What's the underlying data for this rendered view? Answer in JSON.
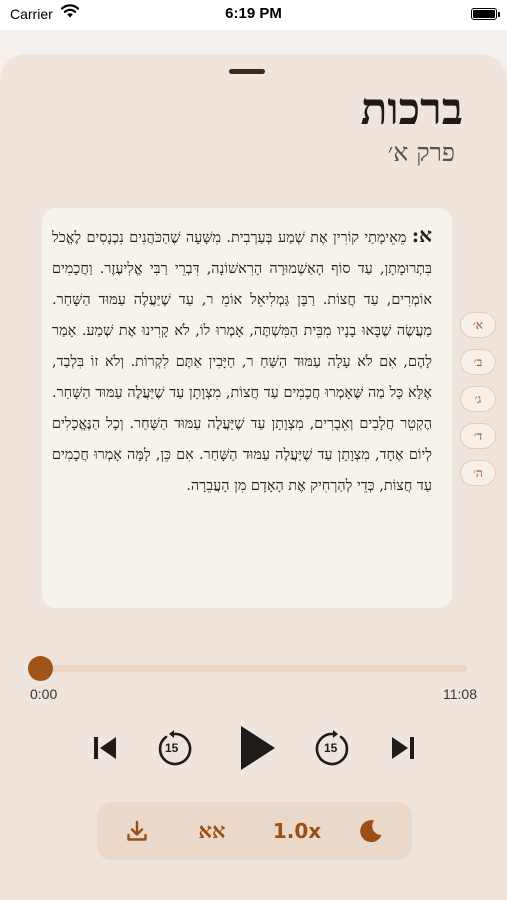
{
  "status_bar": {
    "carrier": "Carrier",
    "time": "6:19 PM",
    "wifi_icon": "wifi-icon",
    "battery_icon": "battery-icon"
  },
  "header": {
    "title": "ברכות",
    "subtitle": "פרק א׳"
  },
  "mishna": {
    "marker": "א:",
    "text": "מֵאֵימָתַי קוֹרִין אֶת שְׁמַע בְּעַרְבִית. מִשָּׁעָה שֶׁהַכֹּהֲנִים נִכְנָסִים לֶאֱכֹל בִּתְרוּמָתָן, עַד סוֹף הָאַשְׁמוּרָה הָרִאשׁוֹנָה, דִּבְרֵי רַבִּי אֱלִיעֶזֶר. וַחֲכָמִים אוֹמְרִים, עַד חֲצוֹת. רַבָּן גַּמְלִיאֵל אוֹמֵ ר, עַד שֶׁיַּעֲלֶה עַמּוּד הַשָּׁחַר. מַעֲשֶׂה שֶׁבָּאוּ בָנָיו מִבֵּית הַמִּשְׁתֶּה, אָמְרוּ לוֹ, לֹא קָרִינוּ אֶת שְׁמַע. אָמַר לָהֶם, אִם לֹא עָלָה עַמּוּד הַשַּׁחַ ר, חַיָּבִין אַתֶּם לִקְרוֹת. וְלֹא זוֹ בִּלְבַד, אֶלָּא כָּל מַה שֶּׁאָמְרוּ חֲכָמִים עַד חֲצוֹת, מִצְוָתָן עַד שֶׁיַּעֲלֶה עַמּוּד הַשָּׁחַר. הֶקְטֵר חֲלָבִים וְאֵבָרִים, מִצְוָתָן עַד שֶׁיַּעֲלֶה עַמּוּד הַשָּׁחַר. וְכָל הַנֶּאֱכָלִים לְיוֹם אֶחָד, מִצְוָתָן עַד שֶׁיַּעֲלֶה עַמּוּד הַשָּׁחַר. אִם כֵּן, לָמָּה אָמְרוּ חֲכָמִים עַד חֲצוֹת, כְּדֵי לְהַרְחִיק אֶת הָאָדָם מִן הָעֲבֵרָה."
  },
  "chapters": [
    "א׳",
    "ב׳",
    "ג׳",
    "ד׳",
    "ה׳"
  ],
  "player": {
    "current_time": "0:00",
    "total_time": "11:08",
    "progress": 0.0,
    "skip_back_seconds": "15",
    "skip_forward_seconds": "15"
  },
  "toolbar": {
    "download_icon": "download-icon",
    "font_toggle": "אא",
    "speed": "1.0x",
    "dark_mode_icon": "moon-icon"
  },
  "colors": {
    "accent": "#9f5518",
    "track": "#ead4c4",
    "sheet": "#efe5dc",
    "card": "#f7f2ec"
  }
}
